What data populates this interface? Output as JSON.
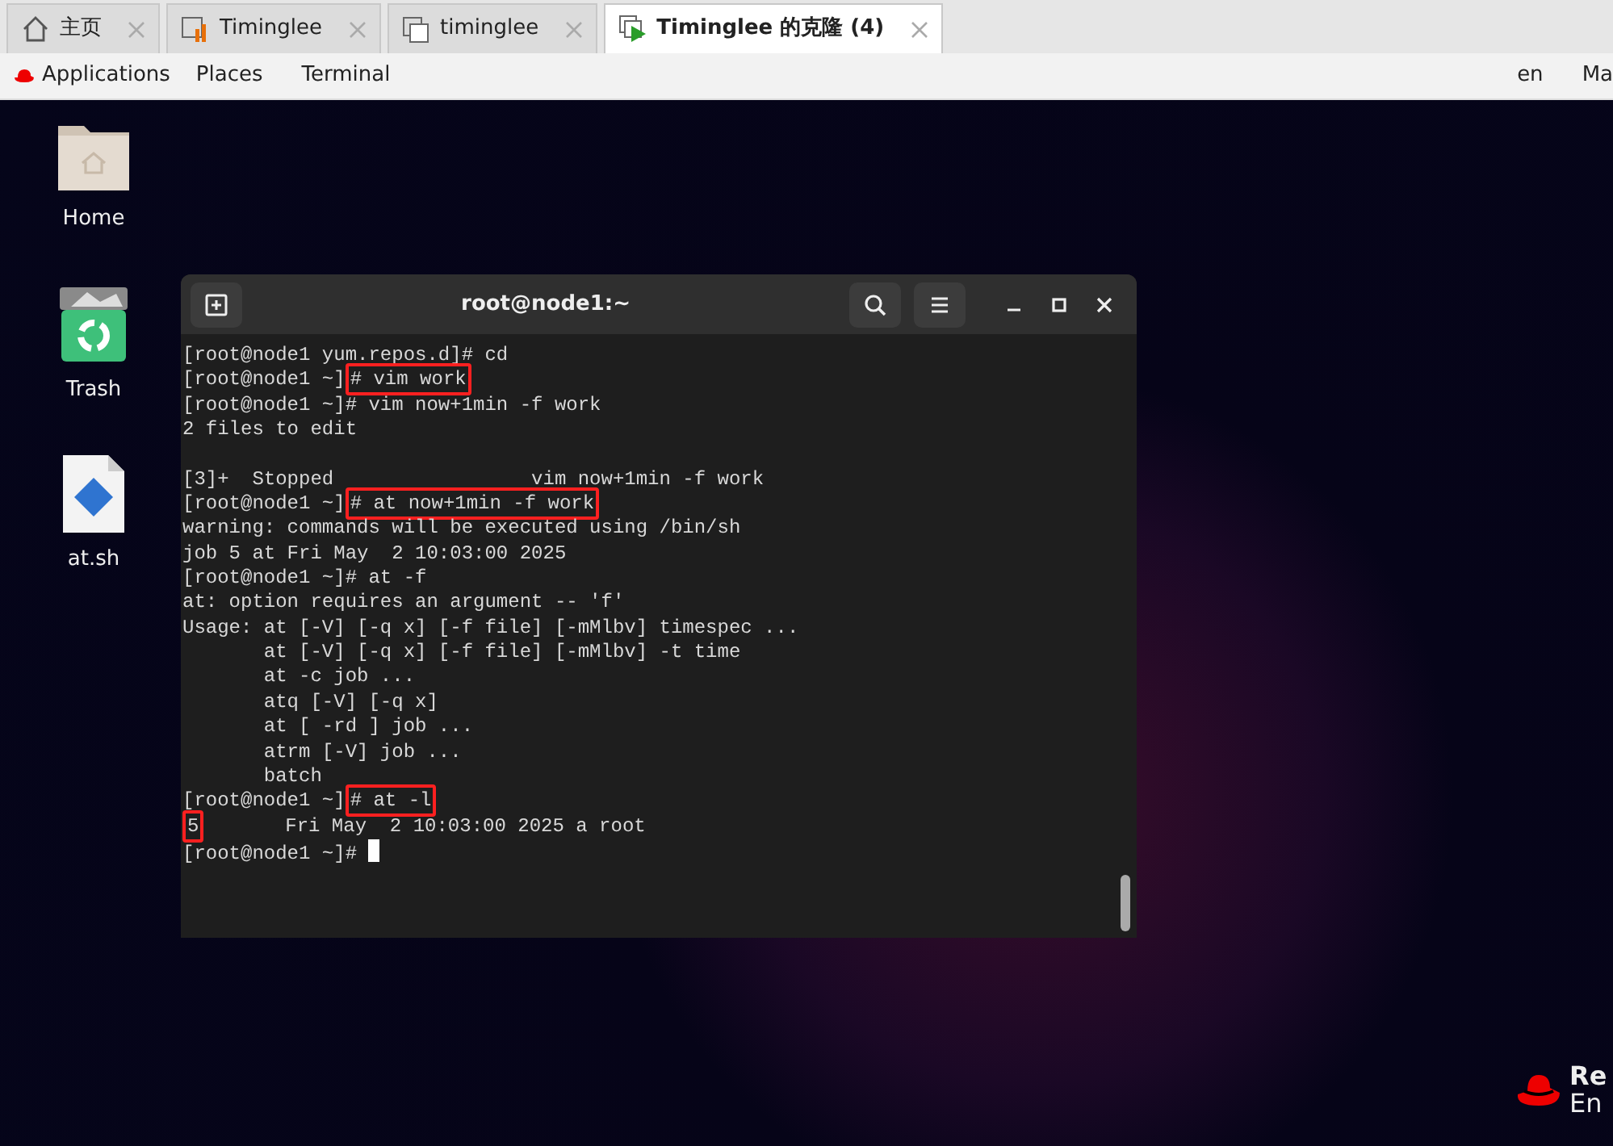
{
  "browser_tabs": [
    {
      "label": "主页",
      "selected": false
    },
    {
      "label": "Timinglee",
      "selected": false
    },
    {
      "label": "timinglee",
      "selected": false
    },
    {
      "label": "Timinglee 的克隆 (4)",
      "selected": true
    }
  ],
  "top_panel": {
    "menus": [
      "Applications",
      "Places",
      "Terminal"
    ],
    "right": [
      "en",
      "Ma"
    ]
  },
  "desktop_icons": [
    {
      "kind": "folder",
      "label": "Home"
    },
    {
      "kind": "trash",
      "label": "Trash"
    },
    {
      "kind": "script",
      "label": "at.sh"
    }
  ],
  "terminal": {
    "title": "root@node1:~",
    "lines": [
      {
        "kind": "text",
        "segments": [
          {
            "text": "[root@node1 yum.repos.d]# cd",
            "boxed": false
          }
        ]
      },
      {
        "kind": "text",
        "segments": [
          {
            "text": "[root@node1 ~]",
            "boxed": false
          },
          {
            "text": "# vim work",
            "boxed": true
          }
        ]
      },
      {
        "kind": "text",
        "segments": [
          {
            "text": "[root@node1 ~]# vim now+1min -f work",
            "boxed": false
          }
        ]
      },
      {
        "kind": "text",
        "segments": [
          {
            "text": "2 files to edit",
            "boxed": false
          }
        ]
      },
      {
        "kind": "blank"
      },
      {
        "kind": "text",
        "segments": [
          {
            "text": "[3]+  Stopped                 vim now+1min -f work",
            "boxed": false
          }
        ]
      },
      {
        "kind": "text",
        "segments": [
          {
            "text": "[root@node1 ~]",
            "boxed": false
          },
          {
            "text": "# at now+1min -f work",
            "boxed": true
          }
        ]
      },
      {
        "kind": "text",
        "segments": [
          {
            "text": "warning: commands will be executed using /bin/sh",
            "boxed": false
          }
        ]
      },
      {
        "kind": "text",
        "segments": [
          {
            "text": "job 5 at Fri May  2 10:03:00 2025",
            "boxed": false
          }
        ]
      },
      {
        "kind": "text",
        "segments": [
          {
            "text": "[root@node1 ~]# at -f",
            "boxed": false
          }
        ]
      },
      {
        "kind": "text",
        "segments": [
          {
            "text": "at: option requires an argument -- 'f'",
            "boxed": false
          }
        ]
      },
      {
        "kind": "text",
        "segments": [
          {
            "text": "Usage: at [-V] [-q x] [-f file] [-mMlbv] timespec ...",
            "boxed": false
          }
        ]
      },
      {
        "kind": "text",
        "segments": [
          {
            "text": "       at [-V] [-q x] [-f file] [-mMlbv] -t time",
            "boxed": false
          }
        ]
      },
      {
        "kind": "text",
        "segments": [
          {
            "text": "       at -c job ...",
            "boxed": false
          }
        ]
      },
      {
        "kind": "text",
        "segments": [
          {
            "text": "       atq [-V] [-q x]",
            "boxed": false
          }
        ]
      },
      {
        "kind": "text",
        "segments": [
          {
            "text": "       at [ -rd ] job ...",
            "boxed": false
          }
        ]
      },
      {
        "kind": "text",
        "segments": [
          {
            "text": "       atrm [-V] job ...",
            "boxed": false
          }
        ]
      },
      {
        "kind": "text",
        "segments": [
          {
            "text": "       batch",
            "boxed": false
          }
        ]
      },
      {
        "kind": "text",
        "segments": [
          {
            "text": "[root@node1 ~]",
            "boxed": false
          },
          {
            "text": "# at -l",
            "boxed": true
          }
        ]
      },
      {
        "kind": "text",
        "segments": [
          {
            "text": "5",
            "boxed": true
          },
          {
            "text": "       Fri May  2 10:03:00 2025 a root",
            "boxed": false
          }
        ]
      },
      {
        "kind": "text",
        "segments": [
          {
            "text": "[root@node1 ~]# ",
            "boxed": false
          }
        ],
        "cursor": true
      }
    ]
  },
  "brand": {
    "lines": [
      "Re",
      "En"
    ]
  }
}
